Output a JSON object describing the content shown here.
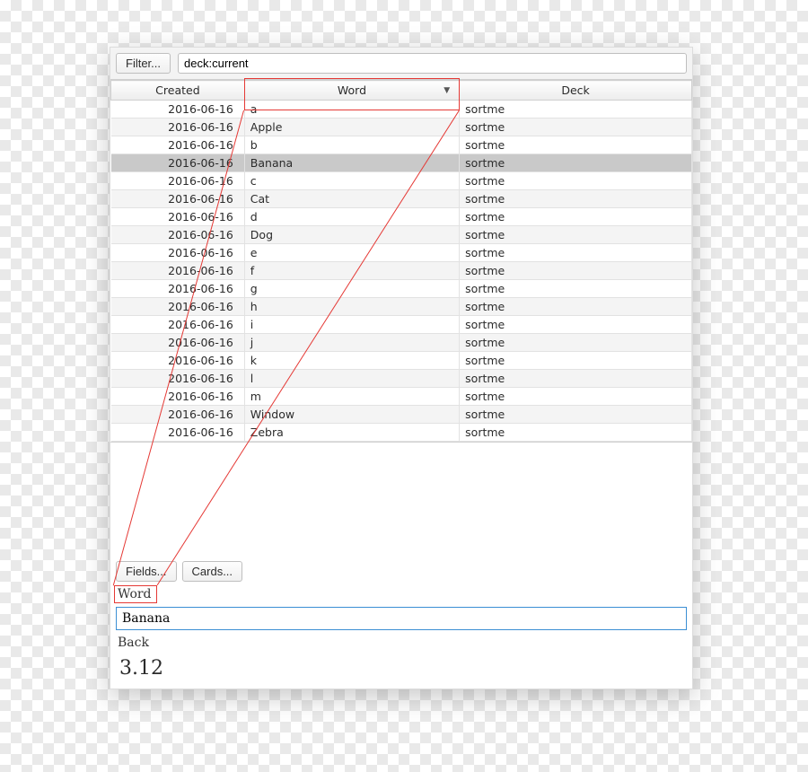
{
  "topbar": {
    "filter_button": "Filter...",
    "search_value": "deck:current"
  },
  "table": {
    "columns": [
      "Created",
      "Word",
      "Deck"
    ],
    "sort_column_index": 1,
    "rows": [
      {
        "created": "2016-06-16",
        "word": "a",
        "deck": "sortme",
        "selected": false
      },
      {
        "created": "2016-06-16",
        "word": "Apple",
        "deck": "sortme",
        "selected": false
      },
      {
        "created": "2016-06-16",
        "word": "b",
        "deck": "sortme",
        "selected": false
      },
      {
        "created": "2016-06-16",
        "word": "Banana",
        "deck": "sortme",
        "selected": true
      },
      {
        "created": "2016-06-16",
        "word": "c",
        "deck": "sortme",
        "selected": false
      },
      {
        "created": "2016-06-16",
        "word": "Cat",
        "deck": "sortme",
        "selected": false
      },
      {
        "created": "2016-06-16",
        "word": "d",
        "deck": "sortme",
        "selected": false
      },
      {
        "created": "2016-06-16",
        "word": "Dog",
        "deck": "sortme",
        "selected": false
      },
      {
        "created": "2016-06-16",
        "word": "e",
        "deck": "sortme",
        "selected": false
      },
      {
        "created": "2016-06-16",
        "word": "f",
        "deck": "sortme",
        "selected": false
      },
      {
        "created": "2016-06-16",
        "word": "g",
        "deck": "sortme",
        "selected": false
      },
      {
        "created": "2016-06-16",
        "word": "h",
        "deck": "sortme",
        "selected": false
      },
      {
        "created": "2016-06-16",
        "word": "i",
        "deck": "sortme",
        "selected": false
      },
      {
        "created": "2016-06-16",
        "word": "j",
        "deck": "sortme",
        "selected": false
      },
      {
        "created": "2016-06-16",
        "word": "k",
        "deck": "sortme",
        "selected": false
      },
      {
        "created": "2016-06-16",
        "word": "l",
        "deck": "sortme",
        "selected": false
      },
      {
        "created": "2016-06-16",
        "word": "m",
        "deck": "sortme",
        "selected": false
      },
      {
        "created": "2016-06-16",
        "word": "Window",
        "deck": "sortme",
        "selected": false
      },
      {
        "created": "2016-06-16",
        "word": "Zebra",
        "deck": "sortme",
        "selected": false
      }
    ]
  },
  "editor": {
    "fields_button": "Fields...",
    "cards_button": "Cards...",
    "field1_label": "Word",
    "field1_value": "Banana",
    "field2_label": "Back",
    "field2_value": "3.12"
  },
  "annotation": {
    "highlight_color": "#e53935"
  }
}
